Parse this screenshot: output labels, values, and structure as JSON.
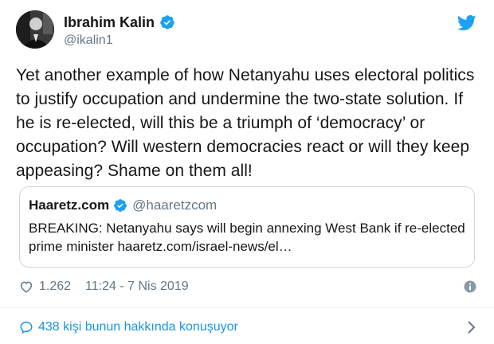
{
  "author": {
    "display_name": "Ibrahim Kalin",
    "handle": "@ikalin1"
  },
  "tweet": {
    "text": "Yet another example of how Netanyahu uses electoral politics to justify occupation and undermine the two-state solution. If he is re-elected, will this be a triumph of ‘democracy’ or occupation? Will western democracies react or will they keep appeasing? Shame on them all!"
  },
  "quoted": {
    "display_name": "Haaretz.com",
    "handle": "@haaretzcom",
    "text": "BREAKING: Netanyahu says will begin annexing West Bank if re-elected prime minister haaretz.com/israel-news/el…"
  },
  "meta": {
    "likes": "1.262",
    "timestamp": "11:24 - 7 Nis 2019"
  },
  "conversation": {
    "label": "438 kişi bunun hakkında konuşuyor"
  },
  "colors": {
    "brand_blue": "#1da1f2",
    "link_blue": "#1b95e0",
    "secondary_text": "#657786",
    "primary_text": "#14171a",
    "border": "#ccd6dd"
  },
  "icons": [
    "verified-badge-icon",
    "twitter-bird-icon",
    "heart-icon",
    "info-icon",
    "speech-bubble-icon",
    "chevron-right-icon"
  ]
}
